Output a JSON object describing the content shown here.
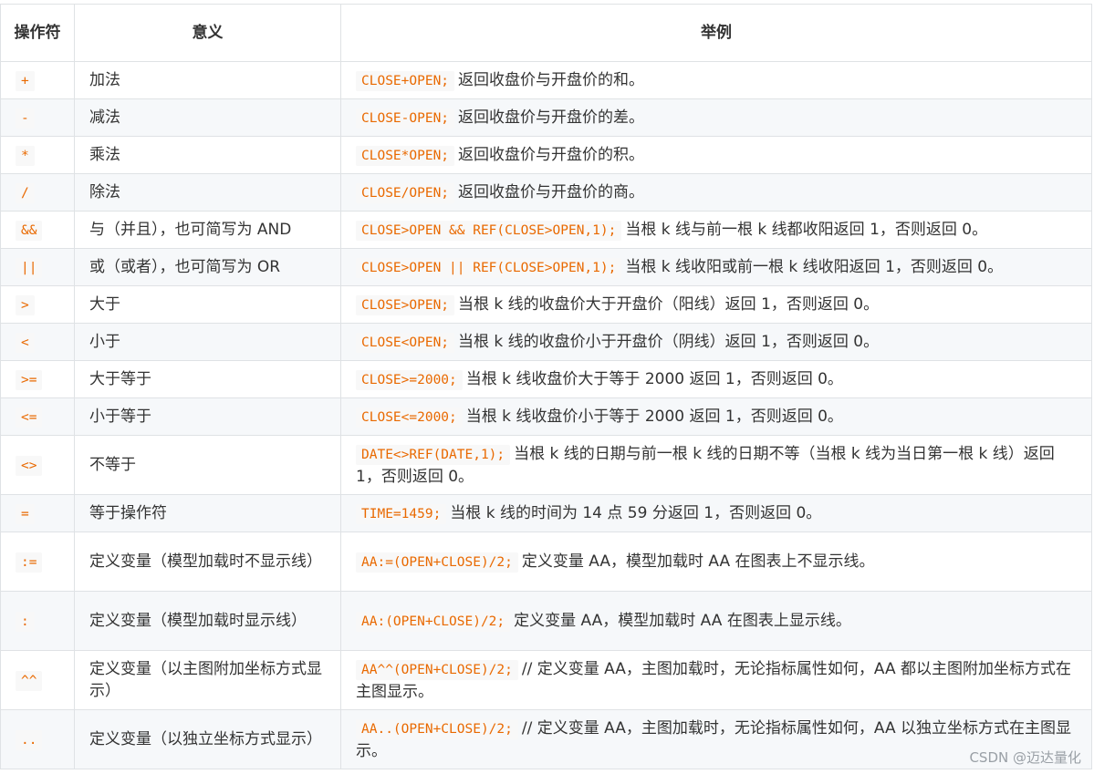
{
  "table": {
    "headers": {
      "operator": "操作符",
      "meaning": "意义",
      "example": "举例"
    },
    "rows": [
      {
        "op": "+",
        "meaning": "加法",
        "code": "CLOSE+OPEN;",
        "desc": "返回收盘价与开盘价的和。"
      },
      {
        "op": "-",
        "meaning": "减法",
        "code": "CLOSE-OPEN;",
        "desc": "返回收盘价与开盘价的差。"
      },
      {
        "op": "*",
        "meaning": "乘法",
        "code": "CLOSE*OPEN;",
        "desc": "返回收盘价与开盘价的积。"
      },
      {
        "op": "/",
        "meaning": "除法",
        "code": "CLOSE/OPEN;",
        "desc": "返回收盘价与开盘价的商。"
      },
      {
        "op": "&&",
        "meaning": "与（并且），也可简写为 AND",
        "code": "CLOSE>OPEN && REF(CLOSE>OPEN,1);",
        "desc": "当根 k 线与前一根 k 线都收阳返回 1，否则返回 0。"
      },
      {
        "op": "||",
        "meaning": "或（或者），也可简写为 OR",
        "code": "CLOSE>OPEN || REF(CLOSE>OPEN,1);",
        "desc": "当根 k 线收阳或前一根 k 线收阳返回 1，否则返回 0。"
      },
      {
        "op": ">",
        "meaning": "大于",
        "code": "CLOSE>OPEN;",
        "desc": "当根 k 线的收盘价大于开盘价（阳线）返回 1，否则返回 0。"
      },
      {
        "op": "<",
        "meaning": "小于",
        "code": "CLOSE<OPEN;",
        "desc": "当根 k 线的收盘价小于开盘价（阴线）返回 1，否则返回 0。"
      },
      {
        "op": ">=",
        "meaning": "大于等于",
        "code": "CLOSE>=2000;",
        "desc": "当根 k 线收盘价大于等于 2000 返回 1，否则返回 0。"
      },
      {
        "op": "<=",
        "meaning": "小于等于",
        "code": "CLOSE<=2000;",
        "desc": "当根 k 线收盘价小于等于 2000 返回 1，否则返回 0。"
      },
      {
        "op": "<>",
        "meaning": "不等于",
        "code": "DATE<>REF(DATE,1);",
        "desc": "当根 k 线的日期与前一根 k 线的日期不等（当根 k 线为当日第一根 k 线）返回 1，否则返回 0。"
      },
      {
        "op": "=",
        "meaning": "等于操作符",
        "code": "TIME=1459;",
        "desc": "当根 k 线的时间为 14 点 59 分返回 1，否则返回 0。"
      },
      {
        "op": ":=",
        "meaning": "定义变量（模型加载时不显示线）",
        "code": "AA:=(OPEN+CLOSE)/2;",
        "desc": "定义变量 AA，模型加载时 AA 在图表上不显示线。"
      },
      {
        "op": ":",
        "meaning": "定义变量（模型加载时显示线）",
        "code": "AA:(OPEN+CLOSE)/2;",
        "desc": "定义变量 AA，模型加载时 AA 在图表上显示线。"
      },
      {
        "op": "^^",
        "meaning": "定义变量（以主图附加坐标方式显示）",
        "code": "AA^^(OPEN+CLOSE)/2;",
        "desc": "// 定义变量 AA，主图加载时，无论指标属性如何，AA 都以主图附加坐标方式在主图显示。"
      },
      {
        "op": "..",
        "meaning": "定义变量（以独立坐标方式显示）",
        "code": "AA..(OPEN+CLOSE)/2;",
        "desc": "// 定义变量 AA，主图加载时，无论指标属性如何，AA 以独立坐标方式在主图显示。"
      }
    ]
  },
  "watermark": "CSDN @迈达量化",
  "colors": {
    "code_text": "#e96900",
    "code_bg": "#f8f8f8",
    "stripe": "#f6f8fa",
    "border": "#dfe2e5"
  }
}
